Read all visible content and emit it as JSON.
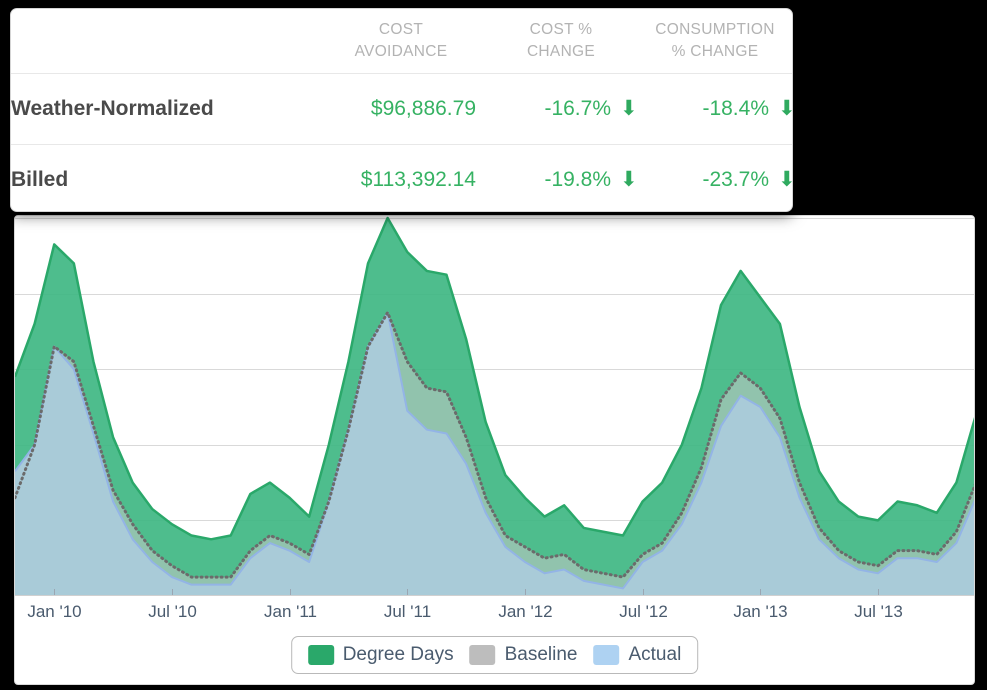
{
  "summary": {
    "columns": [
      {
        "line1": "COST",
        "line2": "AVOIDANCE"
      },
      {
        "line1": "COST %",
        "line2": "CHANGE"
      },
      {
        "line1": "CONSUMPTION",
        "line2": "% CHANGE"
      }
    ],
    "rows": [
      {
        "name": "Weather-Normalized",
        "cost_avoidance": "$96,886.79",
        "cost_pct_change": "-16.7%",
        "cost_pct_arrow": "down",
        "consumption_pct_change": "-18.4%",
        "consumption_pct_arrow": "down"
      },
      {
        "name": "Billed",
        "cost_avoidance": "$113,392.14",
        "cost_pct_change": "-19.8%",
        "cost_pct_arrow": "down",
        "consumption_pct_change": "-23.7%",
        "consumption_pct_arrow": "down"
      }
    ],
    "arrow_glyph": "⬇",
    "positive_color": "#36b263"
  },
  "legend": {
    "items": [
      {
        "label": "Degree Days",
        "color": "#2aa86a"
      },
      {
        "label": "Baseline",
        "color": "#bdbdbd"
      },
      {
        "label": "Actual",
        "color": "#aed2f2"
      }
    ]
  },
  "chart_data": {
    "type": "area",
    "title": "",
    "xlabel": "",
    "ylabel": "",
    "grid": true,
    "legend_position": "bottom",
    "ylim": [
      0,
      100
    ],
    "ytick_values": [
      20,
      40,
      60,
      80,
      100
    ],
    "xtick_labels": [
      "Jan '10",
      "Jul '10",
      "Jan '11",
      "Jul '11",
      "Jan '12",
      "Jul '12",
      "Jan '13",
      "Jul '13"
    ],
    "xtick_indices": [
      2,
      8,
      14,
      20,
      26,
      32,
      38,
      44
    ],
    "x": [
      "Nov '09",
      "Dec '09",
      "Jan '10",
      "Feb '10",
      "Mar '10",
      "Apr '10",
      "May '10",
      "Jun '10",
      "Jul '10",
      "Aug '10",
      "Sep '10",
      "Oct '10",
      "Nov '10",
      "Dec '10",
      "Jan '11",
      "Feb '11",
      "Mar '11",
      "Apr '11",
      "May '11",
      "Jun '11",
      "Jul '11",
      "Aug '11",
      "Sep '11",
      "Oct '11",
      "Nov '11",
      "Dec '11",
      "Jan '12",
      "Feb '12",
      "Mar '12",
      "Apr '12",
      "May '12",
      "Jun '12",
      "Jul '12",
      "Aug '12",
      "Sep '12",
      "Oct '12",
      "Nov '12",
      "Dec '12",
      "Jan '13",
      "Feb '13",
      "Mar '13",
      "Apr '13",
      "May '13",
      "Jun '13",
      "Jul '13",
      "Aug '13",
      "Sep '13",
      "Oct '13",
      "Nov '13",
      "Dec '13"
    ],
    "series": [
      {
        "name": "Degree Days",
        "color": "#2aa86a",
        "values": [
          58,
          72,
          93,
          88,
          62,
          42,
          30,
          23,
          19,
          16,
          15,
          16,
          27,
          30,
          26,
          21,
          40,
          62,
          88,
          100,
          91,
          86,
          85,
          68,
          46,
          32,
          26,
          21,
          24,
          18,
          17,
          16,
          25,
          30,
          40,
          55,
          77,
          86,
          79,
          72,
          50,
          33,
          25,
          21,
          20,
          25,
          24,
          22,
          30,
          48
        ]
      },
      {
        "name": "Baseline",
        "color": "#bdbdbd",
        "values": [
          26,
          40,
          66,
          62,
          45,
          28,
          19,
          12,
          8,
          5,
          5,
          5,
          12,
          16,
          14,
          11,
          25,
          44,
          66,
          75,
          62,
          55,
          54,
          42,
          26,
          16,
          13,
          10,
          11,
          7,
          6,
          5,
          11,
          14,
          22,
          34,
          52,
          59,
          55,
          47,
          30,
          18,
          12,
          9,
          8,
          12,
          12,
          11,
          17,
          30
        ]
      },
      {
        "name": "Actual",
        "color": "#aed2f2",
        "values": [
          33,
          40,
          66,
          60,
          43,
          25,
          15,
          9,
          5,
          3,
          3,
          3,
          10,
          14,
          12,
          9,
          25,
          44,
          66,
          75,
          49,
          44,
          43,
          35,
          22,
          13,
          9,
          6,
          7,
          4,
          3,
          2,
          9,
          12,
          19,
          30,
          45,
          53,
          50,
          42,
          26,
          15,
          10,
          7,
          6,
          10,
          10,
          9,
          14,
          26
        ]
      }
    ]
  }
}
